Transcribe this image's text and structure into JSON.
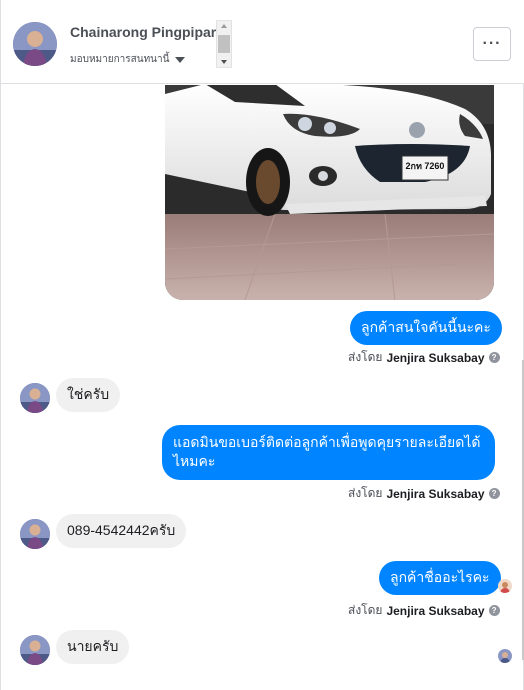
{
  "header": {
    "contact_name": "Chainarong Pingpipart",
    "assign_label": "มอบหมายการสนทนานี้",
    "more_label": "···"
  },
  "messages": [
    {
      "id": "m1",
      "direction": "out",
      "type": "image",
      "image_plate": "2กท 7260"
    },
    {
      "id": "m2",
      "direction": "out",
      "text": "ลูกค้าสนใจคันนี้นะคะ",
      "sent_by_prefix": "ส่งโดย",
      "sender": "Jenjira Suksabay"
    },
    {
      "id": "m3",
      "direction": "in",
      "text": "ใช่ครับ"
    },
    {
      "id": "m4",
      "direction": "out",
      "text_line1": "แอดมินขอเบอร์ติดต่อลูกค้าเพื่อพูดคุยรายละเอียดได้",
      "text_line2": "ไหมคะ",
      "sent_by_prefix": "ส่งโดย",
      "sender": "Jenjira Suksabay"
    },
    {
      "id": "m5",
      "direction": "in",
      "text": "089-4542442ครับ"
    },
    {
      "id": "m6",
      "direction": "out",
      "text": "ลูกค้าชื่ออะไรคะ",
      "sent_by_prefix": "ส่งโดย",
      "sender": "Jenjira Suksabay"
    },
    {
      "id": "m7",
      "direction": "in",
      "text": "นายครับ"
    }
  ],
  "help_glyph": "?",
  "colors": {
    "outgoing": "#0084ff",
    "incoming": "#f1f0f0",
    "border": "#dddfe2"
  }
}
